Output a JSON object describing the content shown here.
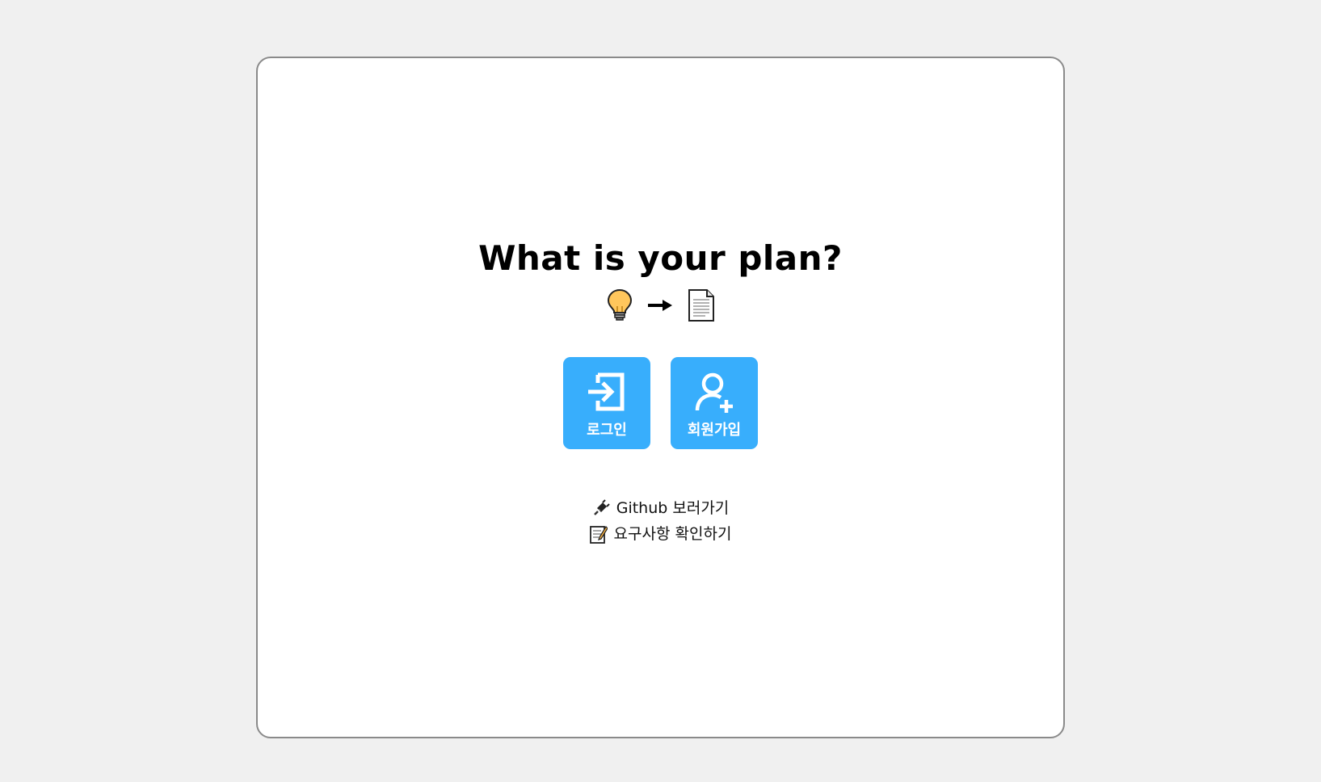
{
  "page": {
    "title": "What is your plan?",
    "emoji": {
      "idea": "lightbulb-icon",
      "arrow": "arrow-right-icon",
      "document": "document-icon"
    }
  },
  "actions": {
    "login": {
      "label": "로그인",
      "icon": "login-icon"
    },
    "signup": {
      "label": "회원가입",
      "icon": "add-user-icon"
    }
  },
  "links": {
    "github": {
      "label": "Github 보러가기",
      "icon": "plug-icon"
    },
    "requirements": {
      "label": "요구사항 확인하기",
      "icon": "memo-icon"
    }
  },
  "colors": {
    "background": "#f0f0f0",
    "card": "#ffffff",
    "card_border": "#8a8a8a",
    "accent": "#38aefc",
    "button_text": "#ffffff"
  }
}
